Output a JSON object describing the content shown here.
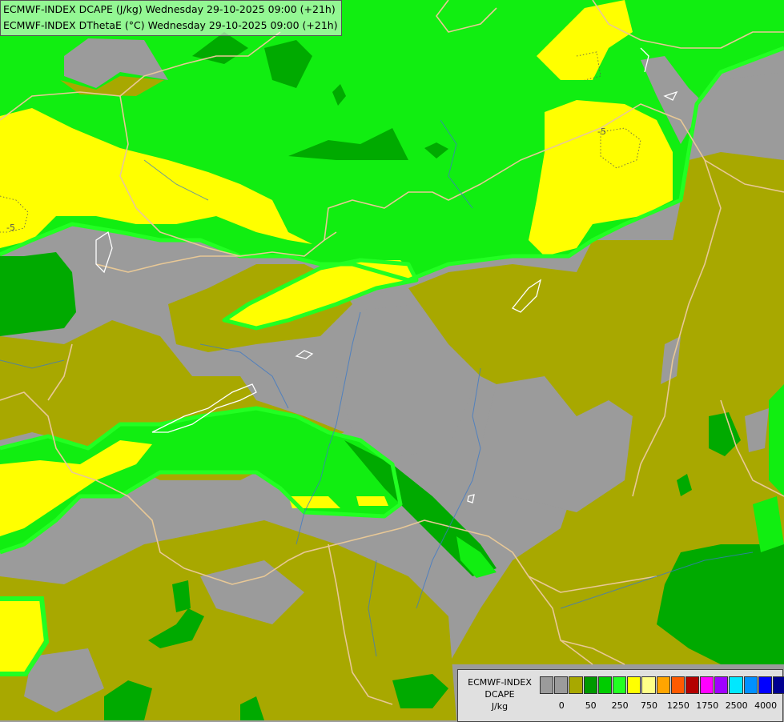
{
  "titles": {
    "line1": "ECMWF-INDEX DCAPE (J/kg) Wednesday 29-10-2025 09:00 (+21h)",
    "line2": "ECMWF-INDEX DThetaE (°C) Wednesday 29-10-2025 09:00 (+21h)"
  },
  "contour_labels": [
    {
      "text": "-5"
    },
    {
      "text": "-5"
    }
  ],
  "legend": {
    "model": "ECMWF-INDEX",
    "param": "DCAPE",
    "unit": "J/kg",
    "colors": [
      "#9b9b9b",
      "#9b9b9b",
      "#a8a800",
      "#009900",
      "#00cc00",
      "#22ff22",
      "#ffff00",
      "#ffff88",
      "#ffa500",
      "#ff5a00",
      "#b40000",
      "#ff00ff",
      "#a000ff",
      "#00e8ff",
      "#0090ff",
      "#0000ff",
      "#000090"
    ],
    "ticks": [
      "0",
      "50",
      "250",
      "750",
      "1250",
      "1750",
      "2500",
      "4000"
    ]
  },
  "palette": {
    "gray": "#9b9b9b",
    "olive": "#a8a800",
    "dark_green": "#00aa00",
    "green": "#11ee11",
    "light_green": "#22ff22",
    "yellow": "#ffff00",
    "border_line": "#e8c896",
    "coast_line": "#ffffff",
    "river_line": "#3a78c8"
  }
}
